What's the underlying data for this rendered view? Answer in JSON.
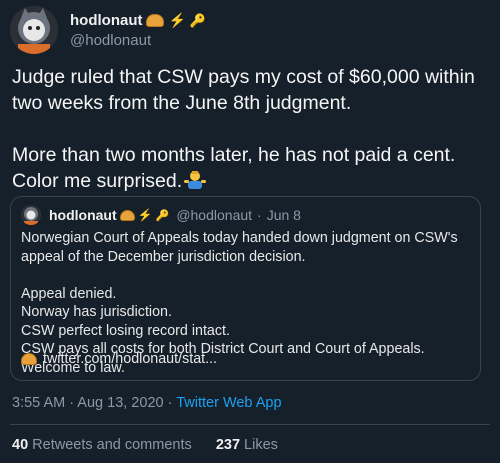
{
  "author": {
    "name": "hodlonaut",
    "handle": "@hodlonaut"
  },
  "tweet": {
    "text": "Judge ruled that CSW pays my cost of $60,000 within two weeks from the June 8th judgment.\n\nMore than two months later, he has not paid a cent. Color me surprised."
  },
  "quoted": {
    "name": "hodlonaut",
    "handle": "@hodlonaut",
    "date": "Jun 8",
    "text": "Norwegian Court of Appeals today handed down judgment on CSW's appeal of the December jurisdiction decision.\n\nAppeal denied.\nNorway has jurisdiction.\nCSW perfect losing record intact.\nCSW pays all costs for both District Court and Court of Appeals.\nWelcome to law.",
    "link": "twitter.com/hodlonaut/stat..."
  },
  "meta": {
    "time": "3:55 AM",
    "date": "Aug 13, 2020",
    "app": "Twitter Web App"
  },
  "stats": {
    "retweets": "40",
    "retweets_label": "Retweets and comments",
    "likes": "237",
    "likes_label": "Likes"
  },
  "icons": [
    "avatar-cat-astronaut",
    "bread-icon",
    "lightning-icon",
    "key-icon",
    "shrug-emoji"
  ]
}
